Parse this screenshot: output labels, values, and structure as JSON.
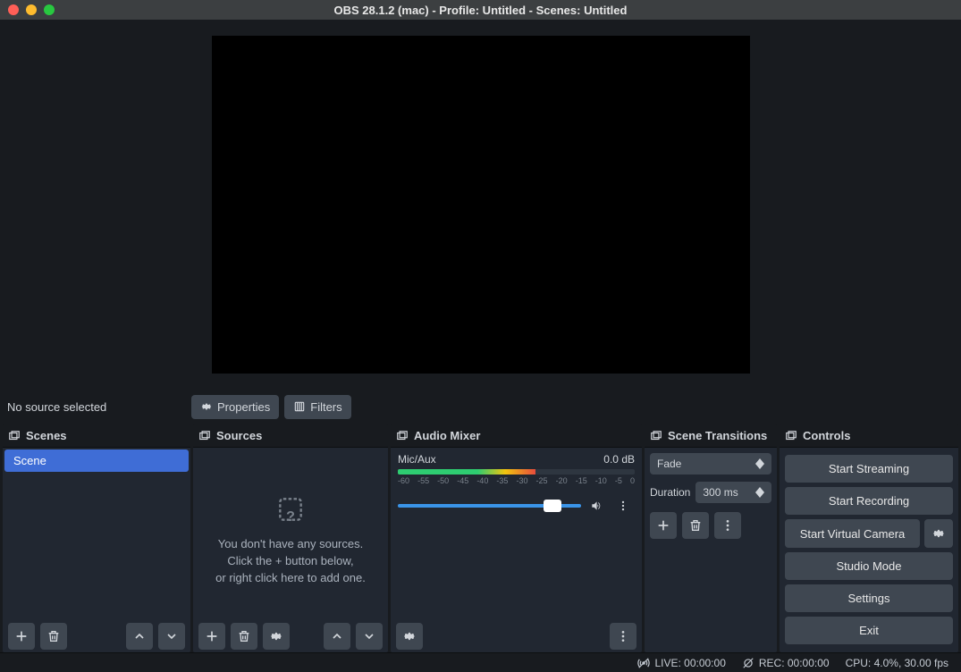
{
  "titlebar": {
    "title": "OBS 28.1.2 (mac) - Profile: Untitled - Scenes: Untitled"
  },
  "source_toolbar": {
    "status": "No source selected",
    "properties_label": "Properties",
    "filters_label": "Filters"
  },
  "docks": {
    "scenes": {
      "title": "Scenes"
    },
    "sources": {
      "title": "Sources"
    },
    "audio": {
      "title": "Audio Mixer"
    },
    "transitions": {
      "title": "Scene Transitions"
    },
    "controls": {
      "title": "Controls"
    }
  },
  "scenes": {
    "items": [
      {
        "name": "Scene"
      }
    ]
  },
  "sources": {
    "empty1": "You don't have any sources.",
    "empty2": "Click the + button below,",
    "empty3": "or right click here to add one."
  },
  "audio": {
    "channel": "Mic/Aux",
    "level": "0.0 dB",
    "ticks": [
      "-60",
      "-55",
      "-50",
      "-45",
      "-40",
      "-35",
      "-30",
      "-25",
      "-20",
      "-15",
      "-10",
      "-5",
      "0"
    ]
  },
  "transitions": {
    "selected": "Fade",
    "duration_label": "Duration",
    "duration_value": "300 ms"
  },
  "controls": {
    "start_streaming": "Start Streaming",
    "start_recording": "Start Recording",
    "start_virtual_camera": "Start Virtual Camera",
    "studio_mode": "Studio Mode",
    "settings": "Settings",
    "exit": "Exit"
  },
  "statusbar": {
    "live": "LIVE: 00:00:00",
    "rec": "REC: 00:00:00",
    "cpu": "CPU: 4.0%, 30.00 fps"
  }
}
